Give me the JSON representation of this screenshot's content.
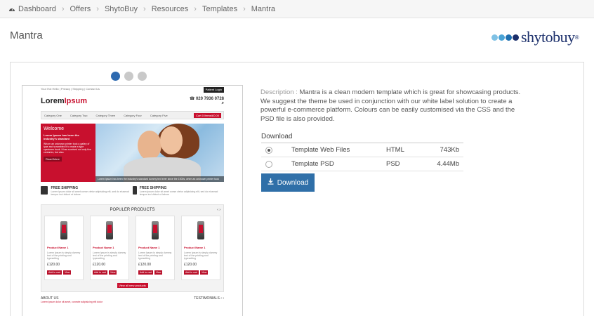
{
  "breadcrumb": {
    "items": [
      "Dashboard",
      "Offers",
      "ShytoBuy",
      "Resources",
      "Templates",
      "Mantra"
    ]
  },
  "page": {
    "title": "Mantra"
  },
  "logo": {
    "text": "shytobuy",
    "reg": "®",
    "dot_colors": [
      "#7fc1e4",
      "#4aa3d6",
      "#1f6fb0",
      "#1b2f6b"
    ]
  },
  "carousel": {
    "active_index": 0,
    "count": 3
  },
  "preview": {
    "top_links": "Your Hot Hello | Privacy | Shipping | Contact Us",
    "login": "Patient Login",
    "logo_a": "Lorem",
    "logo_b": "Ipsum",
    "phone": "020 7936 0728",
    "nav": [
      "Category One",
      "Category Two",
      "Category Three",
      "Category Four",
      "Category Five"
    ],
    "cart": "Cart 0 Items/£0.00",
    "hero": {
      "title": "Welcome",
      "subtitle": "Lorem Ipsum has been the Industry's standard",
      "body": "Whom an unknown printer took a galley of type and scrambled it to make a type specimen book. It has survived not only five centuries, but also.",
      "button": "Read More",
      "caption": "Lorem Ipsum has been the industry's standard dummy text ever since the 1500s, when an unknown printer took"
    },
    "shipping": [
      {
        "title": "FREE SHIPPING",
        "desc": "Lorem ipsum dolor sit amet conse ctetur adipisicing elit, sed do eiusmod tempor inci didunt ut labore"
      },
      {
        "title": "FREE SHIPPING",
        "desc": "Lorem ipsum dolor sit amet conse ctetur adipisicing elit, sed do eiusmod tempor inci didunt ut labore"
      }
    ],
    "products_title": "POPULER PRODUCTS",
    "product": {
      "name": "Product Name 1",
      "desc": "Lorem Ipsum is simply dummy text of the printing and typesetting",
      "price": "£120.00",
      "add": "Add to cart",
      "view": "View"
    },
    "view_all": "View all new products",
    "about": "ABOUT US",
    "testimonials": "TESTIMONIALS",
    "about_link": "Lorem ipsum dolor sit amet, conecte adipisicing elit dolor"
  },
  "description": {
    "label": "Description :",
    "text": "Mantra is a clean modern template which is great for showcasing products. We suggest the theme be used in conjunction with our white label solution to create a powerful e-commerce platform. Colours can be easily customised via the CSS and the PSD file is also provided."
  },
  "download": {
    "title": "Download",
    "rows": [
      {
        "name": "Template Web Files",
        "type": "HTML",
        "size": "743Kb",
        "selected": true
      },
      {
        "name": "Template PSD",
        "type": "PSD",
        "size": "4.44Mb",
        "selected": false
      }
    ],
    "button": "Download"
  }
}
